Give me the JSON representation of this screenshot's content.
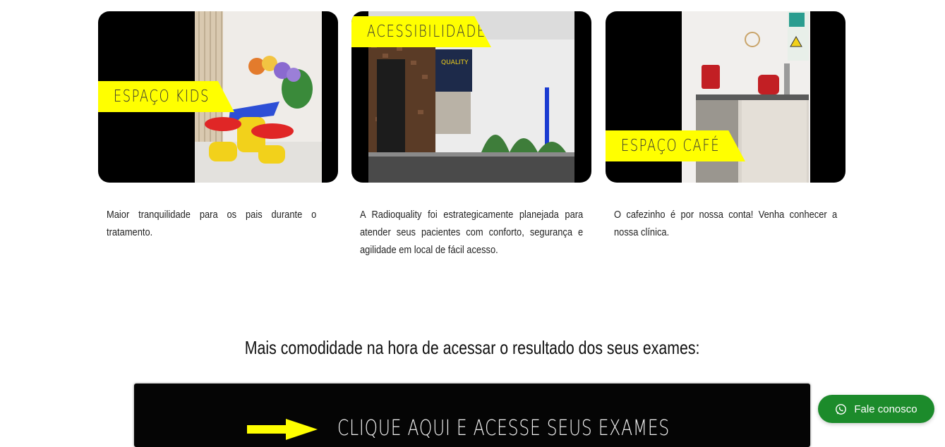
{
  "cards": [
    {
      "banner_label": "ESPAÇO KIDS",
      "description": "Maior tranquilidade para os pais durante o tratamento."
    },
    {
      "banner_label": "ACESSIBILIDADE",
      "storefront_sign": "QUALITY",
      "description": "A Radioquality foi estrategicamente planejada para atender seus pacientes com conforto, segurança e agilidade em  local de fácil acesso."
    },
    {
      "banner_label": "ESPAÇO CAFÉ",
      "description": "O cafezinho é por nossa conta! Venha conhecer a nossa clínica."
    }
  ],
  "results_heading": "Mais comodidade na hora de acessar o resultado dos seus exames:",
  "results_banner": {
    "label": "CLIQUE AQUI E ACESSE SEUS EXAMES",
    "arrow_color": "#ffff00"
  },
  "whatsapp_button": {
    "label": "Fale conosco",
    "icon": "whatsapp-icon",
    "color": "#1c8b2b"
  },
  "colors": {
    "accent_yellow": "#ffff00",
    "card_bg": "#000000"
  }
}
